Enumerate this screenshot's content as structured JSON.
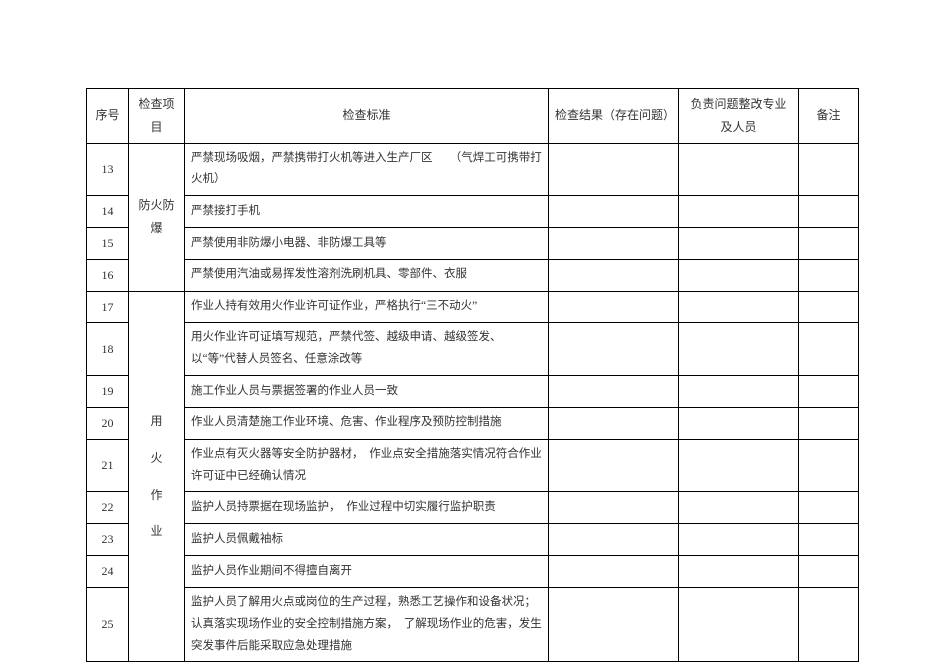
{
  "headers": {
    "seq": "序号",
    "item": "检查项目",
    "standard": "检查标准",
    "result": "检查结果（存在问题）",
    "responsible": "负责问题整改专业及人员",
    "remark": "备注"
  },
  "groups": [
    {
      "label": "防火防爆",
      "label_chars": [
        "防",
        "火",
        "防",
        "爆"
      ],
      "vertical": false,
      "rows": [
        {
          "seq": "13",
          "standard": "严禁现场吸烟，严禁携带打火机等进入生产厂区　　（气焊工可携带打火机）"
        },
        {
          "seq": "14",
          "standard": "严禁接打手机"
        },
        {
          "seq": "15",
          "standard": "严禁使用非防爆小电器、非防爆工具等"
        },
        {
          "seq": "16",
          "standard": "严禁使用汽油或易挥发性溶剂洗刷机具、零部件、衣服"
        }
      ]
    },
    {
      "label": "用火作业",
      "label_chars": [
        "用",
        "火",
        "作",
        "业"
      ],
      "vertical": true,
      "rows": [
        {
          "seq": "17",
          "standard": "作业人持有效用火作业许可证作业，严格执行“三不动火”"
        },
        {
          "seq": "18",
          "standard": "用火作业许可证填写规范，严禁代签、越级申请、越级签发、以“等”代替人员签名、任意涂改等"
        },
        {
          "seq": "19",
          "standard": "施工作业人员与票据签署的作业人员一致"
        },
        {
          "seq": "20",
          "standard": "作业人员清楚施工作业环境、危害、作业程序及预防控制措施"
        },
        {
          "seq": "21",
          "standard": "作业点有灭火器等安全防护器材，　作业点安全措施落实情况符合作业许可证中已经确认情况"
        },
        {
          "seq": "22",
          "standard": "监护人员持票据在现场监护，　作业过程中切实履行监护职责"
        },
        {
          "seq": "23",
          "standard": "监护人员佩戴袖标"
        },
        {
          "seq": "24",
          "standard": "监护人员作业期间不得擅自离开"
        },
        {
          "seq": "25",
          "standard": "监护人员了解用火点或岗位的生产过程，熟悉工艺操作和设备状况；认真落实现场作业的安全控制措施方案，　了解现场作业的危害，发生突发事件后能采取应急处理措施"
        }
      ]
    }
  ]
}
